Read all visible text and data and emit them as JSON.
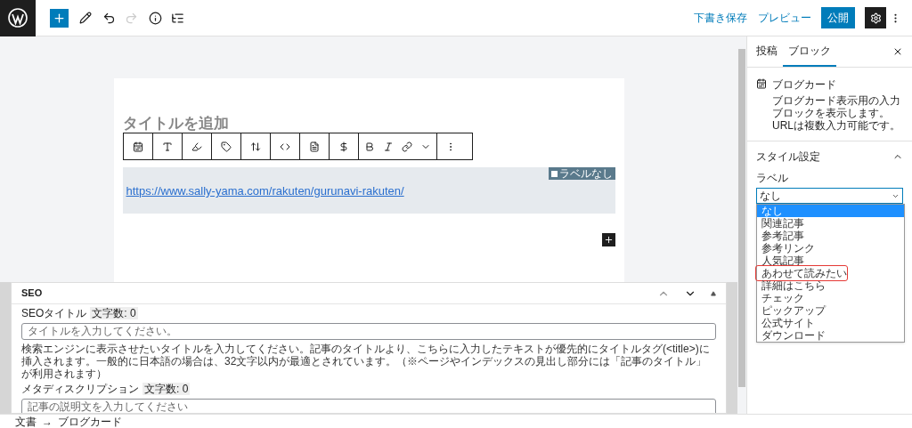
{
  "topbar": {
    "save_draft": "下書き保存",
    "preview": "プレビュー",
    "publish": "公開",
    "settings_selected": true
  },
  "editor": {
    "title_placeholder": "タイトルを追加",
    "url": "https://www.sally-yama.com/rakuten/gurunavi-rakuten/",
    "label_badge": "ラベルなし"
  },
  "seo": {
    "title": "SEO",
    "seo_title_label": "SEOタイトル",
    "seo_title_count": "文字数: 0",
    "seo_title_placeholder": "タイトルを入力してください。",
    "help": "検索エンジンに表示させたいタイトルを入力してください。記事のタイトルより、こちらに入力したテキストが優先的にタイトルタグ(<title>)に挿入されます。一般的に日本語の場合は、32文字以内が最適とされています。（※ページやインデックスの見出し部分には「記事のタイトル」が利用されます）",
    "meta_label": "メタディスクリプション",
    "meta_count": "文字数: 0",
    "meta_placeholder": "記事の説明文を入力してください"
  },
  "breadcrumb": [
    "文書",
    "→",
    "ブログカード"
  ],
  "sidebar": {
    "tabs": [
      {
        "label": "投稿",
        "selected": false
      },
      {
        "label": "ブロック",
        "selected": true
      }
    ],
    "block": {
      "name": "ブログカード",
      "description": "ブログカード表示用の入力ブロックを表示します。URLは複数入力可能です。"
    },
    "section": {
      "title": "スタイル設定",
      "expanded": true
    },
    "label": "ラベル",
    "select_value": "なし",
    "options": [
      {
        "label": "なし",
        "selected": true,
        "annotated": false
      },
      {
        "label": "関連記事",
        "selected": false,
        "annotated": false
      },
      {
        "label": "参考記事",
        "selected": false,
        "annotated": false
      },
      {
        "label": "参考リンク",
        "selected": false,
        "annotated": false
      },
      {
        "label": "人気記事",
        "selected": false,
        "annotated": false
      },
      {
        "label": "あわせて読みたい",
        "selected": false,
        "annotated": true
      },
      {
        "label": "詳細はこちら",
        "selected": false,
        "annotated": false
      },
      {
        "label": "チェック",
        "selected": false,
        "annotated": false
      },
      {
        "label": "ピックアップ",
        "selected": false,
        "annotated": false
      },
      {
        "label": "公式サイト",
        "selected": false,
        "annotated": false
      },
      {
        "label": "ダウンロード",
        "selected": false,
        "annotated": false
      }
    ]
  }
}
